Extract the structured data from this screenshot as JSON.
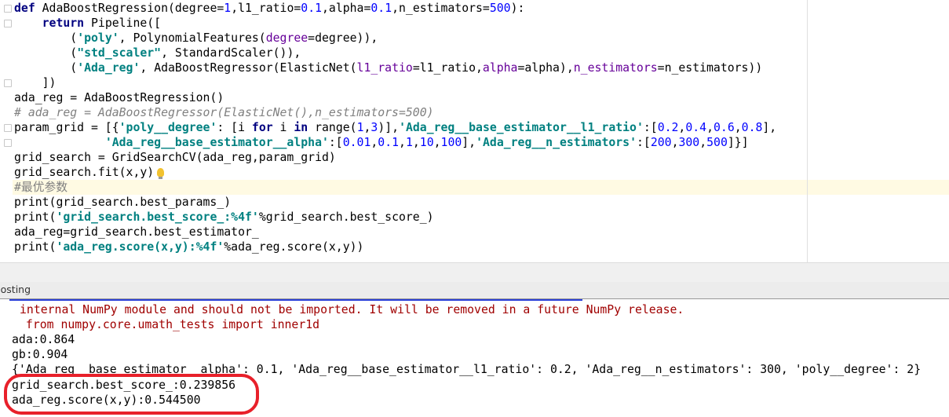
{
  "editor": {
    "lines": [
      [
        [
          "kw",
          "def"
        ],
        [
          "",
          "  AdaBoostRegression(degree="
        ],
        [
          "num",
          "1"
        ],
        [
          "",
          ",l1_ratio="
        ],
        [
          "num",
          "0.1"
        ],
        [
          "",
          ",alpha="
        ],
        [
          "num",
          "0.1"
        ],
        [
          "",
          ",n_estimators="
        ],
        [
          "num",
          "500"
        ],
        [
          "",
          "):"
        ]
      ],
      [
        [
          "",
          "    "
        ],
        [
          "kw",
          "return"
        ],
        [
          "",
          " Pipeline(["
        ]
      ],
      [
        [
          "",
          "        ("
        ],
        [
          "str",
          "'poly'"
        ],
        [
          "",
          ", PolynomialFeatures("
        ],
        [
          "kwarg",
          "degree"
        ],
        [
          "",
          "=degree)),"
        ]
      ],
      [
        [
          "",
          "        ("
        ],
        [
          "str",
          "\"std_scaler\""
        ],
        [
          "",
          ", StandardScaler()),"
        ]
      ],
      [
        [
          "",
          "        ("
        ],
        [
          "str",
          "'Ada_reg'"
        ],
        [
          "",
          ", AdaBoostRegressor(ElasticNet("
        ],
        [
          "kwarg",
          "l1_ratio"
        ],
        [
          "",
          "=l1_ratio,"
        ],
        [
          "kwarg",
          "alpha"
        ],
        [
          "",
          "=alpha),"
        ],
        [
          "kwarg",
          "n_estimators"
        ],
        [
          "",
          "=n_estimators))"
        ]
      ],
      [
        [
          "",
          "    ])"
        ]
      ],
      [
        [
          "",
          "ada_reg = AdaBoostRegression()"
        ]
      ],
      [
        [
          "cmt",
          "# ada_reg = AdaBoostRegressor(ElasticNet(),n_estimators=500)"
        ]
      ],
      [
        [
          "",
          "param_grid = [{"
        ],
        [
          "str",
          "'poly__degree'"
        ],
        [
          "",
          ": [i "
        ],
        [
          "kw",
          "for"
        ],
        [
          "",
          " i "
        ],
        [
          "kw",
          "in"
        ],
        [
          "",
          " range("
        ],
        [
          "num",
          "1"
        ],
        [
          "",
          ","
        ],
        [
          "num",
          "3"
        ],
        [
          "",
          ")],"
        ],
        [
          "str",
          "'Ada_reg__base_estimator__l1_ratio'"
        ],
        [
          "",
          ":["
        ],
        [
          "num",
          "0.2"
        ],
        [
          "",
          ","
        ],
        [
          "num",
          "0.4"
        ],
        [
          "",
          ","
        ],
        [
          "num",
          "0.6"
        ],
        [
          "",
          ","
        ],
        [
          "num",
          "0.8"
        ],
        [
          "",
          "],"
        ]
      ],
      [
        [
          "",
          "             "
        ],
        [
          "str",
          "'Ada_reg__base_estimator__alpha'"
        ],
        [
          "",
          ":["
        ],
        [
          "num",
          "0.01"
        ],
        [
          "",
          ","
        ],
        [
          "num",
          "0.1"
        ],
        [
          "",
          ","
        ],
        [
          "num",
          "1"
        ],
        [
          "",
          ","
        ],
        [
          "num",
          "10"
        ],
        [
          "",
          ","
        ],
        [
          "num",
          "100"
        ],
        [
          "",
          "],"
        ],
        [
          "str",
          "'Ada_reg__n_estimators'"
        ],
        [
          "",
          ":["
        ],
        [
          "num",
          "200"
        ],
        [
          "",
          ","
        ],
        [
          "num",
          "300"
        ],
        [
          "",
          ","
        ],
        [
          "num",
          "500"
        ],
        [
          "",
          "]}]"
        ]
      ],
      [
        [
          "",
          "grid_search = GridSearchCV(ada_reg,param_grid)"
        ]
      ],
      [
        [
          "",
          "grid_search.fit(x,y)"
        ]
      ],
      [
        [
          "cmtcn",
          "#最优参数"
        ]
      ],
      [
        [
          "",
          "print(grid_search.best_params_)"
        ]
      ],
      [
        [
          "",
          "print("
        ],
        [
          "str",
          "'grid_search.best_score_:%4f'"
        ],
        [
          "",
          "%grid_search.best_score_)"
        ]
      ],
      [
        [
          "",
          "ada_reg=grid_search.best_estimator_"
        ]
      ],
      [
        [
          "",
          "print("
        ],
        [
          "str",
          "'ada_reg.score(x,y):%4f'"
        ],
        [
          "",
          "%ada_reg.score(x,y))"
        ]
      ]
    ],
    "colors": {
      "keyword": "#000080",
      "string": "#008080",
      "number": "#0000ff",
      "kwarg": "#660099",
      "comment": "#808080",
      "current_line": "#fffae3"
    },
    "lightbulb_icon": "intention-bulb-icon"
  },
  "run_tab": {
    "label": "oosting"
  },
  "console": {
    "error_lines": [
      "internal NumPy module and should not be imported. It will be removed in a future NumPy release.",
      " from numpy.core.umath_tests import inner1d"
    ],
    "output_lines": [
      "ada:0.864",
      "gb:0.904",
      "{'Ada_reg__base_estimator__alpha': 0.1, 'Ada_reg__base_estimator__l1_ratio': 0.2, 'Ada_reg__n_estimators': 300, 'poly__degree': 2}",
      "grid_search.best_score_:0.239856",
      "ada_reg.score(x,y):0.544500"
    ],
    "colors": {
      "error": "#a00000",
      "annotation": "#e8202a"
    }
  }
}
